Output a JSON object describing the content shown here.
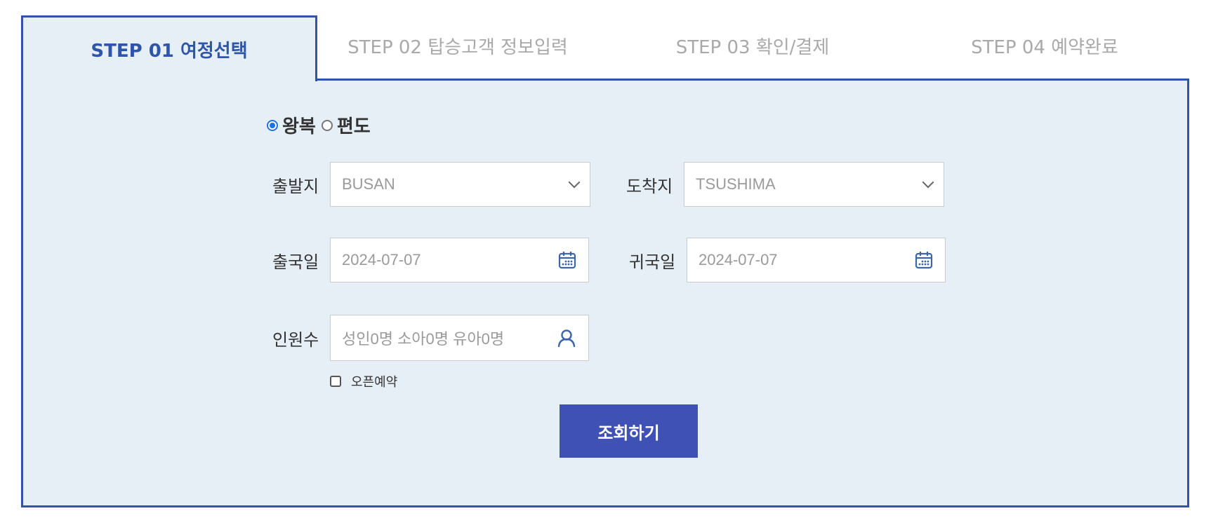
{
  "steps": [
    {
      "label": "STEP 01 여정선택",
      "active": true
    },
    {
      "label": "STEP 02 탑승고객 정보입력",
      "active": false
    },
    {
      "label": "STEP 03 확인/결제",
      "active": false
    },
    {
      "label": "STEP 04 예약완료",
      "active": false
    }
  ],
  "trip_type": {
    "options": [
      "왕복",
      "편도"
    ],
    "selected": "왕복"
  },
  "form": {
    "departure": {
      "label": "출발지",
      "value": "BUSAN"
    },
    "arrival": {
      "label": "도착지",
      "value": "TSUSHIMA"
    },
    "outbound_date": {
      "label": "출국일",
      "value": "2024-07-07"
    },
    "return_date": {
      "label": "귀국일",
      "value": "2024-07-07"
    },
    "passengers": {
      "label": "인원수",
      "placeholder": "성인0명 소아0명 유아0명"
    },
    "open_reservation": {
      "label": "오픈예약",
      "checked": false
    }
  },
  "search_button": "조회하기",
  "colors": {
    "accent": "#2f55a8",
    "panel_bg": "#e6eef6",
    "button": "#3f51b5",
    "inactive_tab": "#a9a9a9"
  },
  "icons": {
    "date": "calendar-icon",
    "passengers": "person-icon",
    "select": "chevron-down-icon"
  }
}
